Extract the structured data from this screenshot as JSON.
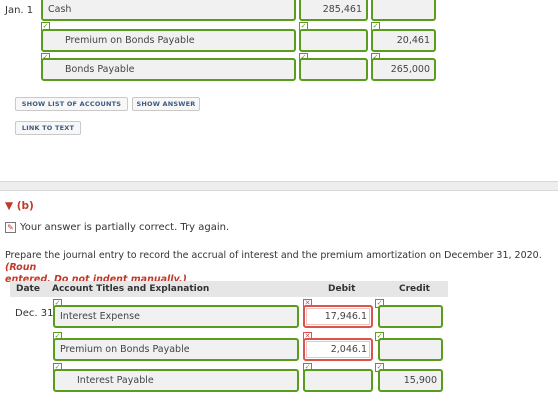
{
  "part_a": {
    "date": "Jan. 1",
    "rows": [
      {
        "account": "Cash",
        "debit": "285,461",
        "credit": ""
      },
      {
        "account": "Premium on Bonds Payable",
        "debit": "",
        "credit": "20,461"
      },
      {
        "account": "Bonds Payable",
        "debit": "",
        "credit": "265,000"
      }
    ],
    "buttons": {
      "show_list": "SHOW LIST OF ACCOUNTS",
      "show_answer": "SHOW ANSWER",
      "link_to_text": "LINK TO TEXT"
    }
  },
  "part_b": {
    "label": "(b)",
    "feedback": "Your answer is partially correct.  Try again.",
    "prompt_plain": "Prepare the journal entry to record the accrual of interest and the premium amortization on December 31, 2020.",
    "prompt_red_1": "(Roun",
    "prompt_red_2": "entered. Do not indent manually.)",
    "headers": {
      "date": "Date",
      "account": "Account Titles and Explanation",
      "debit": "Debit",
      "credit": "Credit"
    },
    "date": "Dec. 31",
    "rows": [
      {
        "account": "Interest Expense",
        "debit": "17,946.1",
        "credit": ""
      },
      {
        "account": "Premium on Bonds Payable",
        "debit": "2,046.1",
        "credit": ""
      },
      {
        "account": "Interest Payable",
        "debit": "",
        "credit": "15,900"
      }
    ]
  }
}
